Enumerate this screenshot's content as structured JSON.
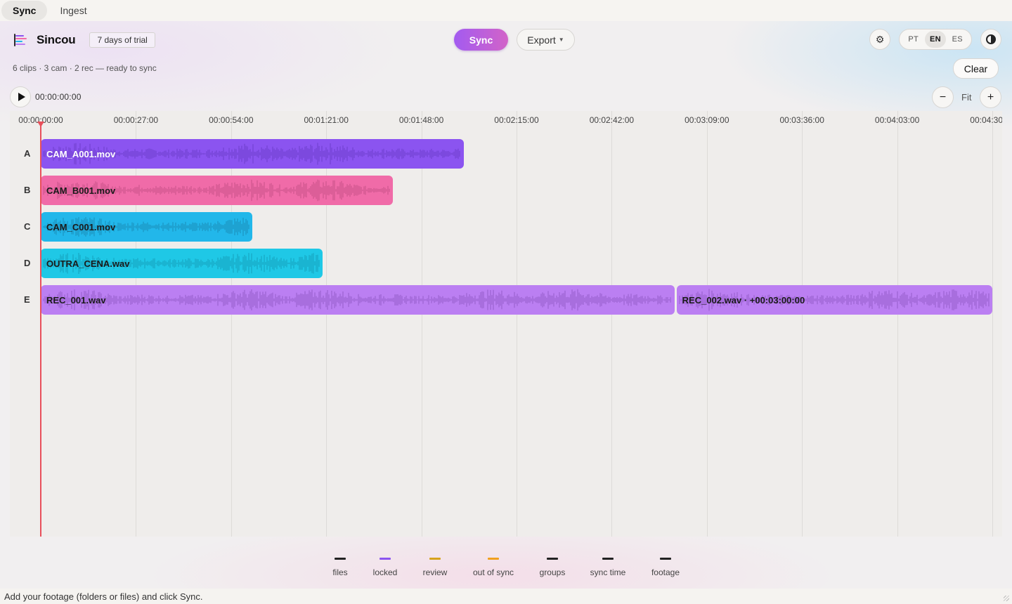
{
  "tabs": [
    {
      "label": "Sync",
      "active": true
    },
    {
      "label": "Ingest",
      "active": false
    }
  ],
  "brand": {
    "name": "Sincou",
    "trial": "7 days of trial"
  },
  "toolbar": {
    "sync_label": "Sync",
    "export_label": "Export",
    "settings_icon": "gear-icon",
    "languages": [
      {
        "code": "PT",
        "active": false
      },
      {
        "code": "EN",
        "active": true
      },
      {
        "code": "ES",
        "active": false
      }
    ],
    "theme_icon": "contrast-icon"
  },
  "status": "6 clips · 3 cam · 2 rec — ready to sync",
  "clear_label": "Clear",
  "transport": {
    "timecode": "00:00:00:00",
    "zoom_fit": "Fit",
    "zoom_out": "−",
    "zoom_in": "+"
  },
  "timeline": {
    "ticks": [
      "00:00:00:00",
      "00:00:27:00",
      "00:00:54:00",
      "00:01:21:00",
      "00:01:48:00",
      "00:02:15:00",
      "00:02:42:00",
      "00:03:09:00",
      "00:03:36:00",
      "00:04:03:00",
      "00:04:30:00"
    ],
    "tick_seconds": [
      0,
      27,
      54,
      81,
      108,
      135,
      162,
      189,
      216,
      243,
      270
    ],
    "total_seconds": 270,
    "tracks": [
      {
        "id": "A",
        "clips": [
          {
            "name": "CAM_A001.mov",
            "start": 0,
            "duration": 120,
            "color": "#8b54f0",
            "wave": "#6a3bc7",
            "text": "#ffffff"
          }
        ]
      },
      {
        "id": "B",
        "clips": [
          {
            "name": "CAM_B001.mov",
            "start": 0,
            "duration": 100,
            "color": "#f06ba8",
            "wave": "#c04d84",
            "text": "#1a1a1a"
          }
        ]
      },
      {
        "id": "C",
        "clips": [
          {
            "name": "CAM_C001.mov",
            "start": 0,
            "duration": 60,
            "color": "#22b7ea",
            "wave": "#1a86b0",
            "text": "#1a1a1a"
          }
        ]
      },
      {
        "id": "D",
        "clips": [
          {
            "name": "OUTRA_CENA.wav",
            "start": 0,
            "duration": 80,
            "color": "#1fc8e6",
            "wave": "#159bb4",
            "text": "#1a1a1a"
          }
        ]
      },
      {
        "id": "E",
        "clips": [
          {
            "name": "REC_001.wav",
            "start": 0,
            "duration": 180,
            "color": "#bb7ff2",
            "wave": "#8f58c4",
            "text": "#1a1a1a"
          },
          {
            "name": "REC_002.wav  ·  +00:03:00:00",
            "start": 180,
            "duration": 90,
            "color": "#bb7ff2",
            "wave": "#8f58c4",
            "text": "#1a1a1a"
          }
        ]
      }
    ]
  },
  "legend": [
    {
      "label": "files",
      "color": "#222222"
    },
    {
      "label": "locked",
      "color": "#8b54f0"
    },
    {
      "label": "review",
      "color": "#d6a21c"
    },
    {
      "label": "out of sync",
      "color": "#f0a020"
    },
    {
      "label": "groups",
      "color": "#222222"
    },
    {
      "label": "sync time",
      "color": "#222222"
    },
    {
      "label": "footage",
      "color": "#222222"
    }
  ],
  "footer": "Add your footage (folders or files) and click Sync."
}
